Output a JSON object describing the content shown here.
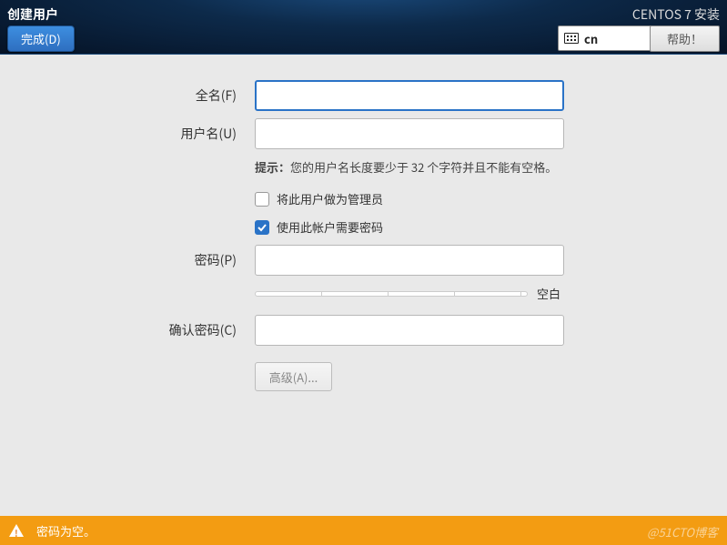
{
  "header": {
    "title": "创建用户",
    "done_label": "完成(D)",
    "install_label": "CENTOS 7 安装",
    "keyboard_layout": "cn",
    "help_label": "帮助！"
  },
  "form": {
    "fullname_label": "全名(F)",
    "fullname_value": "",
    "username_label": "用户名(U)",
    "username_value": "",
    "hint_prefix": "提示：",
    "hint_text": "您的用户名长度要少于 32 个字符并且不能有空格。",
    "admin_checkbox_label": "将此用户做为管理员",
    "admin_checked": false,
    "require_password_label": "使用此帐户需要密码",
    "require_password_checked": true,
    "password_label": "密码(P)",
    "password_value": "",
    "strength_text": "空白",
    "confirm_label": "确认密码(C)",
    "confirm_value": "",
    "advanced_label": "高级(A)..."
  },
  "warning": {
    "message": "密码为空。"
  },
  "watermark": "@51CTO博客"
}
